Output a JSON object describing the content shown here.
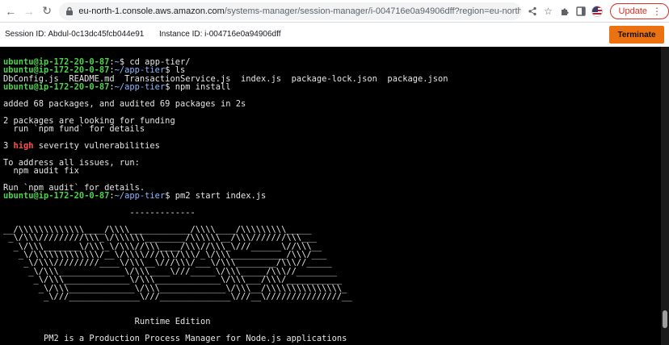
{
  "browser": {
    "url_host": "eu-north-1.console.aws.amazon.com",
    "url_path": "/systems-manager/session-manager/i-004716e0a94906dff?region=eu-north-1",
    "update_label": "Update"
  },
  "session": {
    "session_id_text": "Session ID: Abdul-0c13dc45fcb044e91",
    "instance_id_text": "Instance ID: i-004716e0a94906dff",
    "terminate_label": "Terminate"
  },
  "terminal": {
    "lines": [
      [
        [
          "u",
          "ubuntu@ip-172-20-0-87"
        ],
        [
          "t",
          ":"
        ],
        [
          "p",
          "~"
        ],
        [
          "t",
          "$ cd app-tier/"
        ]
      ],
      [
        [
          "u",
          "ubuntu@ip-172-20-0-87"
        ],
        [
          "t",
          ":"
        ],
        [
          "p",
          "~/app-tier"
        ],
        [
          "t",
          "$ ls"
        ]
      ],
      [
        [
          "t",
          "DbConfig.js  README.md  TransactionService.js  index.js  package-lock.json  package.json"
        ]
      ],
      [
        [
          "u",
          "ubuntu@ip-172-20-0-87"
        ],
        [
          "t",
          ":"
        ],
        [
          "p",
          "~/app-tier"
        ],
        [
          "t",
          "$ npm install"
        ]
      ],
      [
        [
          "t",
          ""
        ]
      ],
      [
        [
          "t",
          "added 68 packages, and audited 69 packages in 2s"
        ]
      ],
      [
        [
          "t",
          ""
        ]
      ],
      [
        [
          "t",
          "2 packages are looking for funding"
        ]
      ],
      [
        [
          "t",
          "  run `npm fund` for details"
        ]
      ],
      [
        [
          "t",
          ""
        ]
      ],
      [
        [
          "t",
          "3 "
        ],
        [
          "r",
          "high"
        ],
        [
          "t",
          " severity vulnerabilities"
        ]
      ],
      [
        [
          "t",
          ""
        ]
      ],
      [
        [
          "t",
          "To address all issues, run:"
        ]
      ],
      [
        [
          "t",
          "  npm audit fix"
        ]
      ],
      [
        [
          "t",
          ""
        ]
      ],
      [
        [
          "t",
          "Run `npm audit` for details."
        ]
      ],
      [
        [
          "u",
          "ubuntu@ip-172-20-0-87"
        ],
        [
          "t",
          ":"
        ],
        [
          "p",
          "~/app-tier"
        ],
        [
          "t",
          "$ pm2 start index.js"
        ]
      ],
      [
        [
          "t",
          ""
        ]
      ],
      [
        [
          "t",
          "                         -------------"
        ]
      ],
      [
        [
          "t",
          ""
        ]
      ],
      [
        [
          "t",
          "__/\\\\\\\\\\\\\\\\\\\\\\\\\\____/\\\\\\\\____________/\\\\\\\\____/\\\\\\\\\\\\\\\\\\_____"
        ]
      ],
      [
        [
          "t",
          " _\\/\\\\\\/////////\\\\\\_\\/\\\\\\\\\\\\________/\\\\\\\\\\\\__/\\\\\\///////\\\\\\___"
        ]
      ],
      [
        [
          "t",
          "  _\\/\\\\\\_______\\/\\\\\\_\\/\\\\\\//\\\\\\____/\\\\\\//\\\\\\_\\///______\\//\\\\\\__"
        ]
      ],
      [
        [
          "t",
          "   _\\/\\\\\\\\\\\\\\\\\\\\\\\\\\/__\\/\\\\\\\\///\\\\\\/\\\\\\/_\\/\\\\\\___________/\\\\\\/___"
        ]
      ],
      [
        [
          "t",
          "    _\\/\\\\\\/////////____\\/\\\\\\__\\///\\\\\\/___\\/\\\\\\________/\\\\\\//_____"
        ]
      ],
      [
        [
          "t",
          "     _\\/\\\\\\_____________\\/\\\\\\____\\///_____\\/\\\\\\_____/\\\\\\//________"
        ]
      ],
      [
        [
          "t",
          "      _\\/\\\\\\_____________\\/\\\\\\_____________\\/\\\\\\___/\\\\\\/___________"
        ]
      ],
      [
        [
          "t",
          "       _\\/\\\\\\_____________\\/\\\\\\_____________\\/\\\\\\__/\\\\\\\\\\\\\\\\\\\\\\\\\\\\\\_"
        ]
      ],
      [
        [
          "t",
          "        _\\///______________\\///______________\\///__\\///////////////__"
        ]
      ],
      [
        [
          "t",
          ""
        ]
      ],
      [
        [
          "t",
          ""
        ]
      ],
      [
        [
          "t",
          "                          Runtime Edition"
        ]
      ],
      [
        [
          "t",
          ""
        ]
      ],
      [
        [
          "t",
          "        PM2 is a Production Process Manager for Node.js applications"
        ]
      ]
    ]
  },
  "colors": {
    "accent": "#ec7211",
    "prompt_user": "#4fd34f",
    "prompt_path": "#8cb8ff",
    "severity_high": "#ff4d4d"
  }
}
